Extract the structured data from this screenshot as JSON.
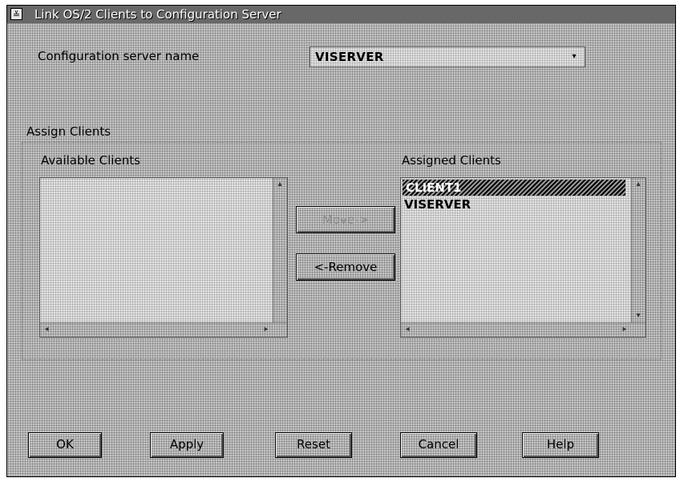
{
  "window": {
    "title": "Link OS/2 Clients to Configuration Server",
    "system_menu_glyph": "≚"
  },
  "server_field": {
    "label": "Configuration server name",
    "value": "VISERVER",
    "dropdown_glyph": "▾"
  },
  "assign_group": {
    "label": "Assign Clients",
    "available": {
      "label": "Available Clients",
      "items": []
    },
    "assigned": {
      "label": "Assigned Clients",
      "items": [
        "CLIENT1",
        "VISERVER"
      ],
      "selected": "CLIENT1"
    }
  },
  "transfer_buttons": {
    "move": "Move->",
    "remove": "<-Remove",
    "move_enabled": false
  },
  "footer_buttons": {
    "ok": "OK",
    "apply": "Apply",
    "reset": "Reset",
    "cancel": "Cancel",
    "help": "Help"
  },
  "scroll_glyphs": {
    "up": "▴",
    "down": "▾",
    "left": "◂",
    "right": "▸"
  }
}
